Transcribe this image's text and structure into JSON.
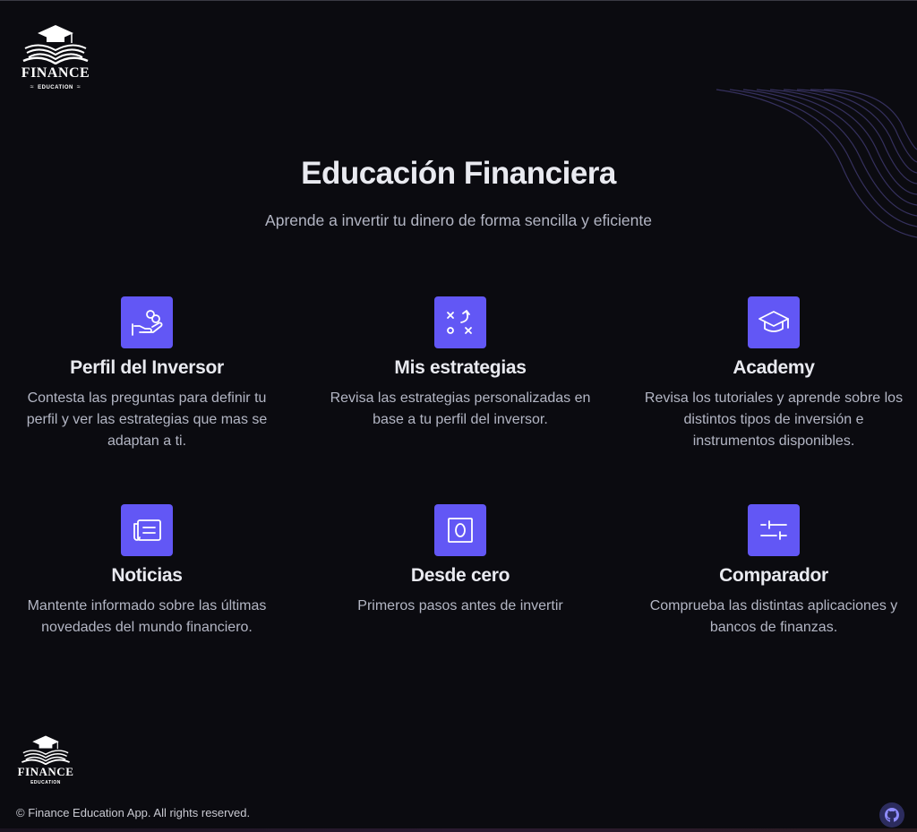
{
  "brand": {
    "logo_word": "FINANCE",
    "logo_sub": "EDUCATION",
    "icon": "graduation-book-logo-icon"
  },
  "hero": {
    "title": "Educación Financiera",
    "subtitle": "Aprende a invertir tu dinero de forma sencilla y eficiente"
  },
  "features": [
    {
      "title": "Perfil del Inversor",
      "description": "Contesta las preguntas para definir tu perfil y ver las estrategias que mas se adaptan a ti.",
      "icon": "hand-coins-icon"
    },
    {
      "title": "Mis estrategias",
      "description": "Revisa las estrategias personalizadas en base a tu perfil del inversor.",
      "icon": "strategy-play-icon"
    },
    {
      "title": "Academy",
      "description": "Revisa los tutoriales y aprende sobre los distintos tipos de inversión e instrumentos disponibles.",
      "icon": "graduation-cap-icon"
    },
    {
      "title": "Noticias",
      "description": "Mantente informado sobre las últimas novedades del mundo financiero.",
      "icon": "newspaper-icon"
    },
    {
      "title": "Desde cero",
      "description": "Primeros pasos antes de invertir",
      "icon": "zero-icon"
    },
    {
      "title": "Comparador",
      "description": "Comprueba las distintas aplicaciones y bancos de finanzas.",
      "icon": "sliders-icon"
    }
  ],
  "footer": {
    "copyright": "© Finance Education App. All rights reserved.",
    "github_icon": "github-icon"
  },
  "colors": {
    "background": "#0b0b10",
    "accent": "#6257f5",
    "text": "#e9eaf0",
    "muted": "#b3b6c4"
  }
}
